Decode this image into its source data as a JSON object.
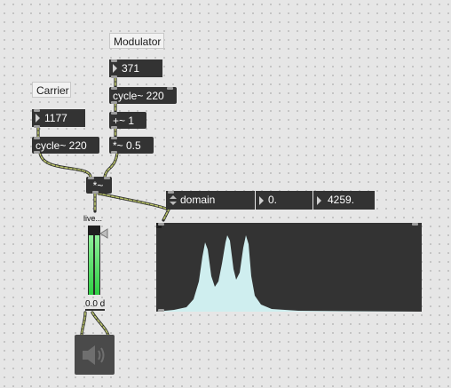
{
  "comments": {
    "modulator": "Modulator",
    "carrier": "Carrier"
  },
  "modulator": {
    "freq_number": "371",
    "osc": "cycle~ 220",
    "add": "+~ 1",
    "mult": "*~ 0.5"
  },
  "carrier": {
    "freq_number": "1177",
    "osc": "cycle~ 220"
  },
  "ring_mod": "*~",
  "meter": {
    "label": "live...",
    "level": 0.86,
    "gain_readout": "0.0 d"
  },
  "spectroscope": {
    "mode": "domain",
    "low": "0.",
    "high": "4259."
  },
  "colors": {
    "object_bg": "#333333",
    "patch_cord": "#b9c36a",
    "meter_green": "#3ddc4a",
    "spectrum_fill": "#cfeeef"
  },
  "icons": {
    "speaker": "speaker-icon"
  }
}
